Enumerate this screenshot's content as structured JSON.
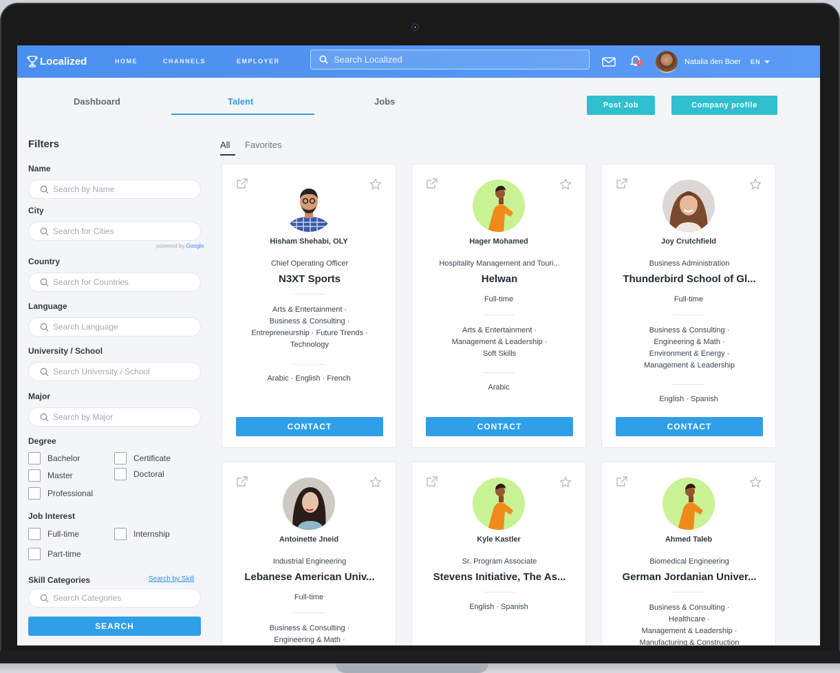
{
  "nav": {
    "logo": "Localized",
    "links": [
      "HOME",
      "CHANNELS",
      "EMPLOYER"
    ],
    "search_placeholder": "Search Localized",
    "notifications_count": "1",
    "user_name": "Natalia den Boer",
    "language": "EN"
  },
  "tabs": [
    "Dashboard",
    "Talent",
    "Jobs"
  ],
  "actions": {
    "post_job": "Post Job",
    "company_profile": "Company profile"
  },
  "filters": {
    "title": "Filters",
    "name_label": "Name",
    "name_placeholder": "Search by Name",
    "city_label": "City",
    "city_placeholder": "Search for Cities",
    "powered_by": "powered by",
    "google": "Google",
    "country_label": "Country",
    "country_placeholder": "Search for Countries",
    "language_label": "Language",
    "language_placeholder": "Search Language",
    "university_label": "University / School",
    "university_placeholder": "Search University / School",
    "major_label": "Major",
    "major_placeholder": "Search by Major",
    "degree_label": "Degree",
    "degrees": [
      "Bachelor",
      "Certificate",
      "Master",
      "Doctoral",
      "Professional"
    ],
    "job_interest_label": "Job Interest",
    "job_interests": [
      "Full-time",
      "Internship",
      "Part-time"
    ],
    "skill_label": "Skill Categories",
    "skill_link": "Search by Skill",
    "skill_placeholder": "Search Categories",
    "search_button": "SEARCH"
  },
  "subtabs": [
    "All",
    "Favorites"
  ],
  "cards": [
    {
      "name": "Hisham Shehabi, OLY",
      "role": "Chief Operating Officer",
      "org": "N3XT Sports",
      "type": "",
      "skills": [
        "Arts & Entertainment ·",
        "Business & Consulting ·",
        "Entrepreneurship · Future Trends ·",
        "Technology"
      ],
      "languages": "Arabic · English · French",
      "contact": "CONTACT"
    },
    {
      "name": "Hager Mohamed",
      "role": "Hospitality Management and Touri...",
      "org": "Helwan",
      "type": "Full-time",
      "skills": [
        "Arts & Entertainment ·",
        "Management & Leadership ·",
        "Soft Skills"
      ],
      "languages": "Arabic",
      "contact": "CONTACT"
    },
    {
      "name": "Joy Crutchfield",
      "role": "Business Administration",
      "org": "Thunderbird School of Gl...",
      "type": "Full-time",
      "skills": [
        "Business & Consulting ·",
        "Engineering & Math ·",
        "Environment & Energy ·",
        "Management & Leadership"
      ],
      "languages": "English · Spanish",
      "contact": "CONTACT"
    },
    {
      "name": "Antoinette Jneid",
      "role": "Industrial Engineering",
      "org": "Lebanese American Univ...",
      "type": "Full-time",
      "skills": [
        "Business & Consulting ·",
        "Engineering & Math ·"
      ],
      "languages": "",
      "contact": ""
    },
    {
      "name": "Kyle Kastler",
      "role": "Sr. Program Associate",
      "org": "Stevens Initiative, The As...",
      "type": "",
      "skills": [],
      "languages": "English · Spanish",
      "contact": ""
    },
    {
      "name": "Ahmed Taleb",
      "role": "Biomedical Engineering",
      "org": "German Jordanian Univer...",
      "type": "",
      "skills": [
        "Business & Consulting ·",
        "Healthcare ·",
        "Management & Leadership ·",
        "Manufacturing & Construction"
      ],
      "languages": "",
      "contact": ""
    }
  ],
  "colors": {
    "primary": "#2f9fe8",
    "accent": "#2fbfcf",
    "nav": "#4a8ff0"
  }
}
